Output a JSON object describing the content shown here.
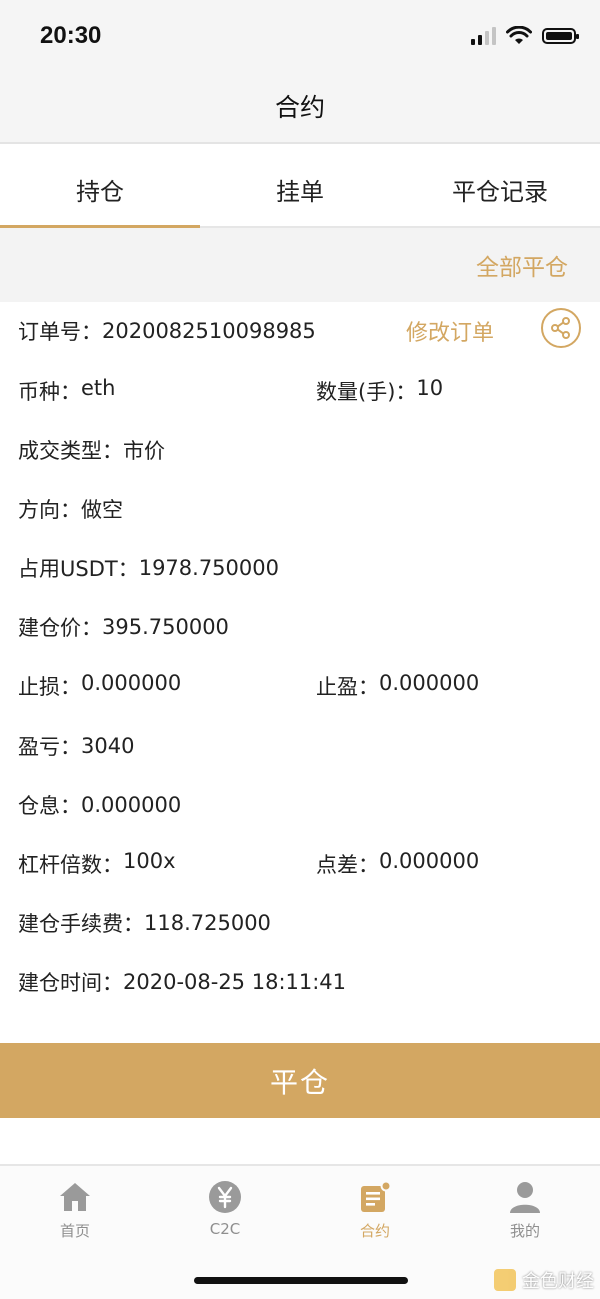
{
  "status": {
    "time": "20:30"
  },
  "nav": {
    "title": "合约"
  },
  "tabs": [
    {
      "label": "持仓",
      "active": true
    },
    {
      "label": "挂单",
      "active": false
    },
    {
      "label": "平仓记录",
      "active": false
    }
  ],
  "actions": {
    "close_all": "全部平仓"
  },
  "order": {
    "order_no_label": "订单号：",
    "order_no": "2020082510098985",
    "modify_label": "修改订单",
    "coin_label": "币种：",
    "coin": "eth",
    "qty_label": "数量(手)：",
    "qty": "10",
    "deal_type_label": "成交类型：",
    "deal_type": "市价",
    "direction_label": "方向：",
    "direction": "做空",
    "usdt_label": "占用USDT：",
    "usdt": "1978.750000",
    "open_price_label": "建仓价：",
    "open_price": "395.750000",
    "stop_loss_label": "止损：",
    "stop_loss": "0.000000",
    "take_profit_label": "止盈：",
    "take_profit": "0.000000",
    "pnl_label": "盈亏：",
    "pnl": "3040",
    "interest_label": "仓息：",
    "interest": "0.000000",
    "leverage_label": "杠杆倍数：",
    "leverage": "100x",
    "spread_label": "点差：",
    "spread": "0.000000",
    "fee_label": "建仓手续费：",
    "fee": "118.725000",
    "open_time_label": "建仓时间：",
    "open_time": "2020-08-25 18:11:41"
  },
  "close_button": "平仓",
  "tabbar": [
    {
      "label": "首页",
      "icon": "home-icon"
    },
    {
      "label": "C2C",
      "icon": "yen-icon"
    },
    {
      "label": "合约",
      "icon": "contract-icon"
    },
    {
      "label": "我的",
      "icon": "user-icon"
    }
  ],
  "watermark": {
    "text": "金色财经"
  },
  "colors": {
    "accent": "#d3a762",
    "tab_inactive": "#8f8f8f"
  }
}
